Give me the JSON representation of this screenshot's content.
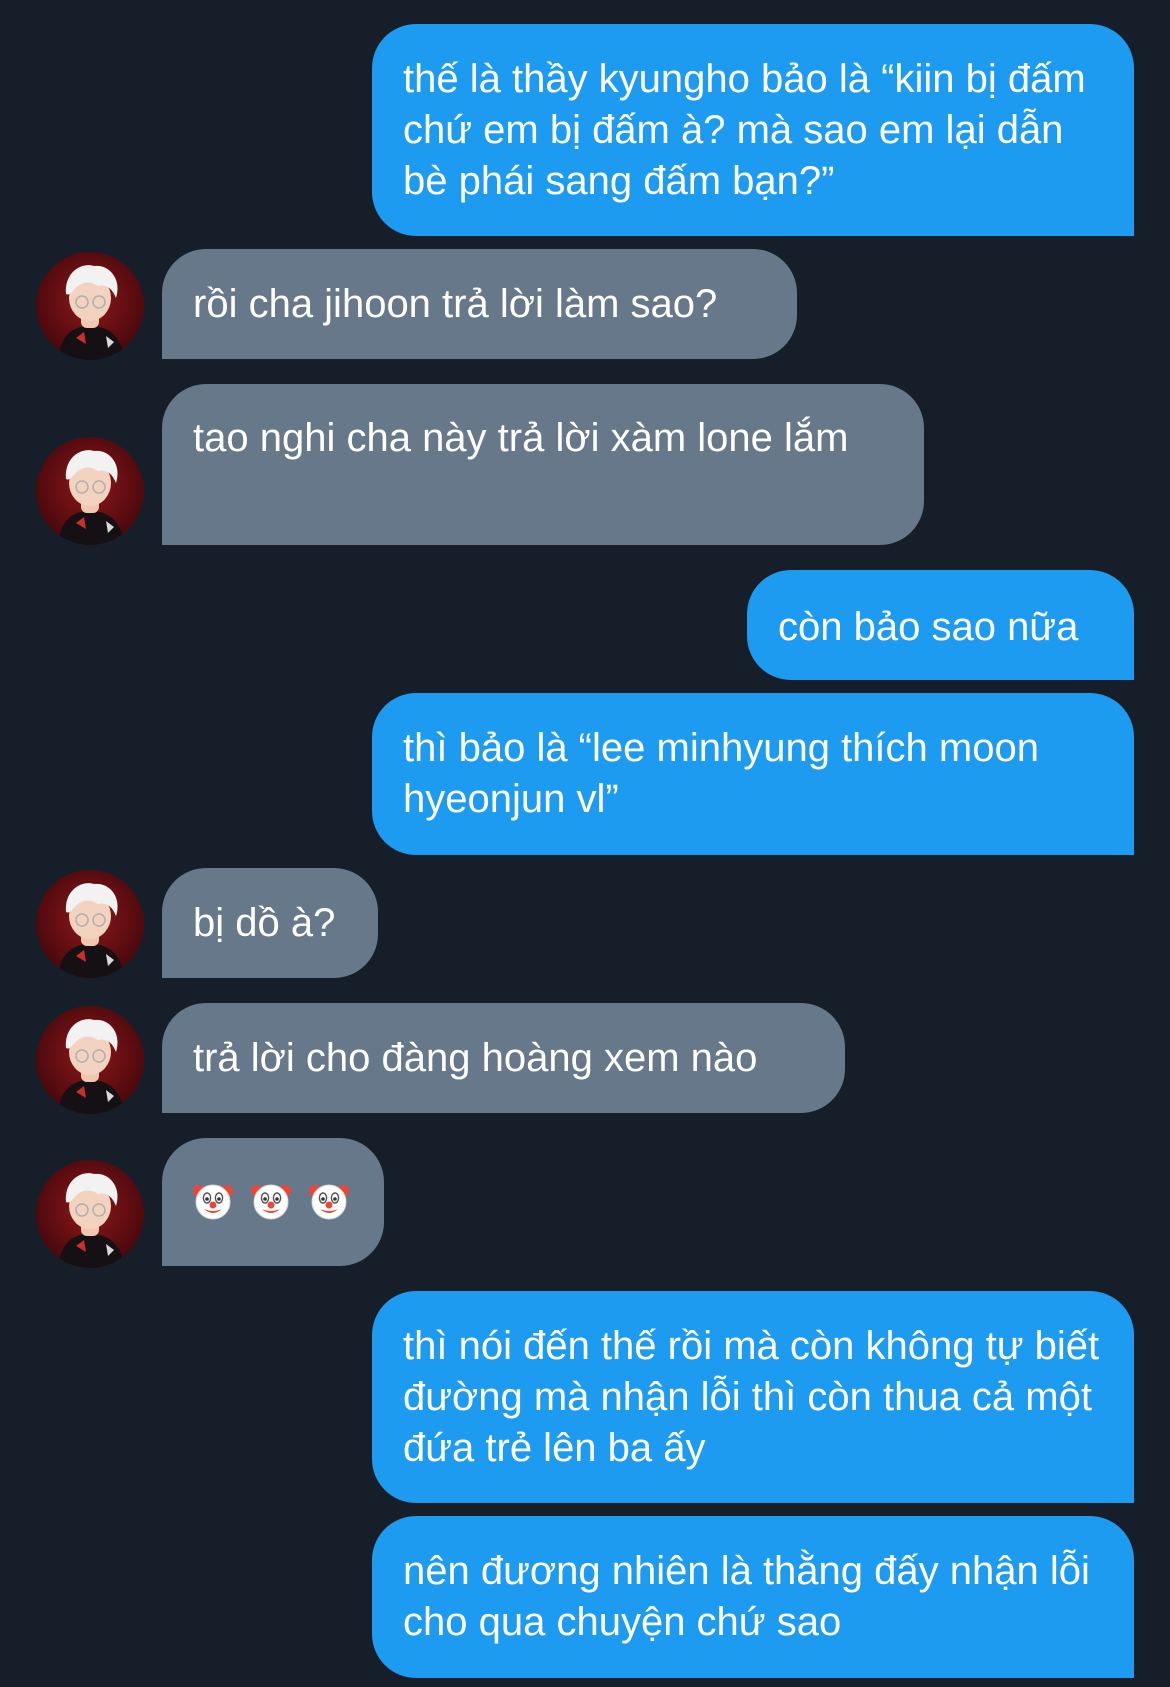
{
  "messages": [
    {
      "side": "out",
      "text": "thế là thầy kyungho bảo là “kiin bị đấm chứ em bị đấm à? mà sao em lại dẫn bè phái sang đấm bạn?”"
    },
    {
      "side": "in",
      "text": "rồi cha jihoon trả lời làm sao?"
    },
    {
      "side": "in",
      "text": "tao nghi cha này trả lời xàm lone lắm"
    },
    {
      "side": "out",
      "text": "còn bảo sao nữa"
    },
    {
      "side": "out",
      "text": "thì bảo là “lee minhyung thích moon hyeonjun vl”"
    },
    {
      "side": "in",
      "text": "bị dồ à?"
    },
    {
      "side": "in",
      "text": "trả lời cho đàng hoàng xem nào"
    },
    {
      "side": "in",
      "emoji": [
        "clown-face-icon",
        "clown-face-icon",
        "clown-face-icon"
      ]
    },
    {
      "side": "out",
      "text": "thì nói đến thế rồi mà còn không tự biết đường mà nhận lỗi thì còn thua cả một đứa trẻ lên ba ấy"
    },
    {
      "side": "out",
      "text": "nên đương nhiên là thằng đấy nhận lỗi cho qua chuyện chứ sao"
    }
  ],
  "colors": {
    "background": "#161f29",
    "outgoing_bubble": "#1d9bf0",
    "incoming_bubble": "#66788a",
    "text": "#ffffff"
  }
}
